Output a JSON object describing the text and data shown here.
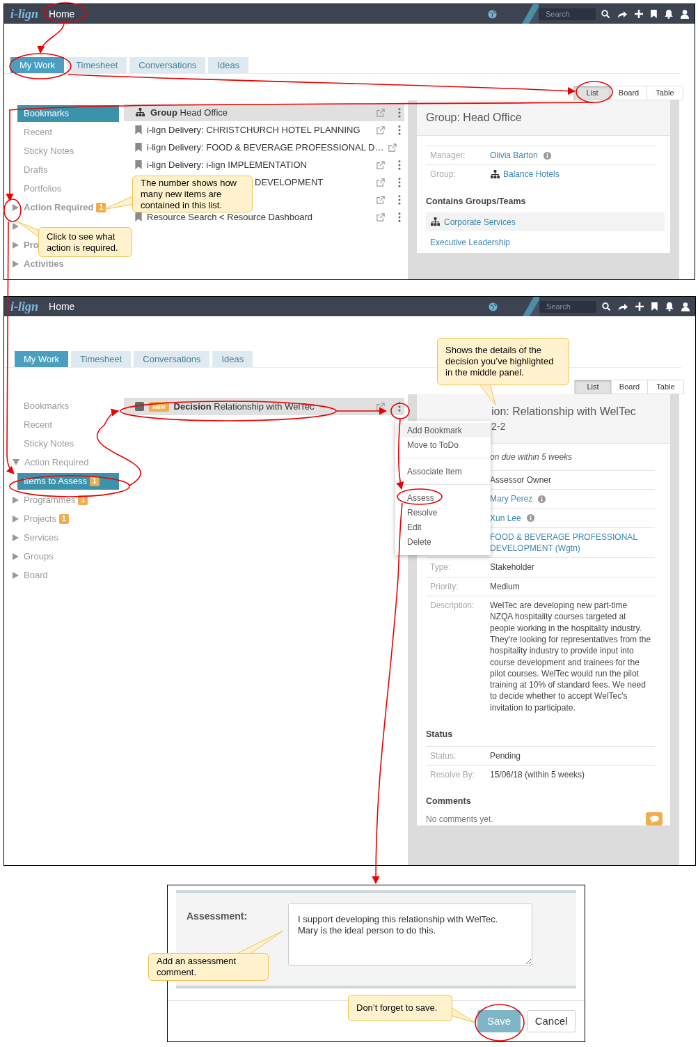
{
  "screens": [
    {
      "topbar": {
        "logo": "i-lign",
        "title": "Home",
        "search_placeholder": "Search"
      },
      "tabs": [
        {
          "label": "My Work",
          "selected": true
        },
        {
          "label": "Timesheet",
          "selected": false
        },
        {
          "label": "Conversations",
          "selected": false
        },
        {
          "label": "Ideas",
          "selected": false
        }
      ],
      "views": [
        {
          "label": "List",
          "selected": true
        },
        {
          "label": "Board",
          "selected": false
        },
        {
          "label": "Table",
          "selected": false
        }
      ],
      "sidebar": [
        {
          "kind": "link",
          "label": "Bookmarks",
          "selected": true
        },
        {
          "kind": "link",
          "label": "Recent",
          "selected": false
        },
        {
          "kind": "link",
          "label": "Sticky Notes",
          "selected": false
        },
        {
          "kind": "link",
          "label": "Drafts",
          "selected": false
        },
        {
          "kind": "link",
          "label": "Portfolios",
          "selected": false
        },
        {
          "kind": "folder",
          "label": "Action Required",
          "badge": "1",
          "selected": false,
          "expanded": false
        },
        {
          "kind": "folder",
          "selected": false,
          "expanded": false
        },
        {
          "kind": "folder",
          "label": "Pro",
          "selected": false,
          "expanded": false
        },
        {
          "kind": "folder",
          "label": "Activities",
          "selected": false,
          "expanded": false
        }
      ],
      "list": [
        {
          "kind": "group",
          "text": "**Group** Head Office",
          "selected": true
        },
        {
          "kind": "bookmark",
          "text": "i-lign Delivery: CHRISTCHURCH HOTEL PLANNING",
          "selected": false
        },
        {
          "kind": "bookmark",
          "text": "i-lign Delivery: FOOD & BEVERAGE PROFESSIONAL D…",
          "selected": false
        },
        {
          "kind": "bookmark",
          "text": "i-lign Delivery: i-lign IMPLEMENTATION",
          "selected": false
        },
        {
          "kind": "covered",
          "text": "DEVELOPMENT",
          "selected": false
        },
        {
          "kind": "covered",
          "selected": false
        },
        {
          "kind": "bookmark",
          "text": "Resource Search < Resource Dashboard",
          "selected": false
        }
      ],
      "detail": {
        "kind": "group",
        "title": "Group: Head Office",
        "sections": [
          {
            "fields": [
              {
                "kind": "person",
                "label": "Manager:",
                "value": "Olivia Barton"
              },
              {
                "kind": "group",
                "label": "Group:",
                "value": "Balance Hotels"
              }
            ]
          },
          {
            "heading": "Contains Groups/Teams",
            "fields": [
              {
                "kind": "team",
                "value": "Corporate Services"
              },
              {
                "kind": "member",
                "value": "Executive Leadership"
              }
            ]
          }
        ]
      }
    },
    {
      "topbar": {
        "logo": "i-lign",
        "title": "Home",
        "search_placeholder": "Search"
      },
      "tabs": [
        {
          "label": "My Work",
          "selected": true
        },
        {
          "label": "Timesheet",
          "selected": false
        },
        {
          "label": "Conversations",
          "selected": false
        },
        {
          "label": "Ideas",
          "selected": false
        }
      ],
      "views": [
        {
          "label": "List",
          "selected": true
        },
        {
          "label": "Board",
          "selected": false
        },
        {
          "label": "Table",
          "selected": false
        }
      ],
      "sidebar": [
        {
          "kind": "link",
          "label": "Bookmarks",
          "selected": false
        },
        {
          "kind": "link",
          "label": "Recent",
          "selected": false
        },
        {
          "kind": "link",
          "label": "Sticky Notes",
          "selected": false
        },
        {
          "kind": "folder",
          "label": "Action Required",
          "selected": false,
          "expanded": true,
          "children": [
            {
              "kind": "link",
              "label": "Items to Assess",
              "badge": "1",
              "selected": true
            }
          ]
        },
        {
          "kind": "folder",
          "label": "Programmes",
          "badge": "1",
          "selected": false,
          "expanded": false
        },
        {
          "kind": "folder",
          "label": "Projects",
          "badge": "1",
          "selected": false,
          "expanded": false
        },
        {
          "kind": "folder",
          "label": "Services",
          "selected": false,
          "expanded": false
        },
        {
          "kind": "folder",
          "label": "Groups",
          "selected": false,
          "expanded": false
        },
        {
          "kind": "folder",
          "label": "Board",
          "selected": false,
          "expanded": false
        }
      ],
      "list": [
        {
          "kind": "decision",
          "badge": "New",
          "text": "**Decision** Relationship with WelTec",
          "selected": true
        }
      ],
      "menu": {
        "groups": [
          {
            "items": [
              {
                "label": "Add Bookmark",
                "selected": true
              },
              {
                "label": "Move to ToDo",
                "selected": false
              }
            ]
          },
          {
            "items": [
              {
                "label": "Associate Item",
                "selected": false
              }
            ]
          },
          {
            "items": [
              {
                "label": "Assess",
                "selected": false
              },
              {
                "label": "Resolve",
                "selected": false
              },
              {
                "label": "Edit",
                "selected": false
              },
              {
                "label": "Delete",
                "selected": false
              }
            ]
          }
        ]
      },
      "detail": {
        "kind": "decision",
        "title": "ion: Relationship with WelTec",
        "subtitle": "2-2",
        "note": "on due within 5 weeks",
        "sections": [
          {
            "fields": [
              {
                "kind": "text",
                "value": "Assessor Owner"
              },
              {
                "kind": "person",
                "value": "Mary Perez"
              },
              {
                "kind": "person",
                "value": "Xun Lee"
              },
              {
                "kind": "link",
                "value": "FOOD & BEVERAGE PROFESSIONAL DEVELOPMENT (Wgtn)"
              },
              {
                "kind": "text",
                "label": "Type:",
                "value": "Stakeholder"
              },
              {
                "kind": "text",
                "label": "Priority:",
                "value": "Medium"
              },
              {
                "kind": "text",
                "label": "Description:",
                "value": "WelTec are developing new part-time NZQA hospitality courses targeted at people working in the hospitality industry. They're looking for representatives from the hospitality industry to provide input into course development and trainees for the pilot courses. WelTec would run the pilot training at 10% of standard fees. We need to decide whether to accept WelTec's invitation to participate."
              }
            ]
          },
          {
            "heading": "Status",
            "fields": [
              {
                "kind": "text",
                "label": "Status:",
                "value": "Pending"
              },
              {
                "kind": "text",
                "label": "Resolve By:",
                "value": "15/06/18 (within 5 weeks)"
              }
            ]
          }
        ],
        "comments": {
          "heading": "Comments",
          "text": "No comments yet."
        }
      }
    }
  ],
  "assessment": {
    "label": "Assessment:",
    "value": "I support developing this relationship with WelTec.\nMary is the ideal person to do this.",
    "buttons": [
      {
        "label": "Save",
        "kind": "primary"
      },
      {
        "label": "Cancel",
        "kind": "secondary"
      }
    ]
  },
  "callouts": [
    {
      "text": "The number shows how many new items are contained in this list."
    },
    {
      "text": "Click to see what action is required."
    },
    {
      "text": "Shows the details of the decision you’ve highlighted in the middle panel."
    },
    {
      "text": "Add an assessment comment."
    },
    {
      "text": "Don’t forget to save."
    }
  ]
}
